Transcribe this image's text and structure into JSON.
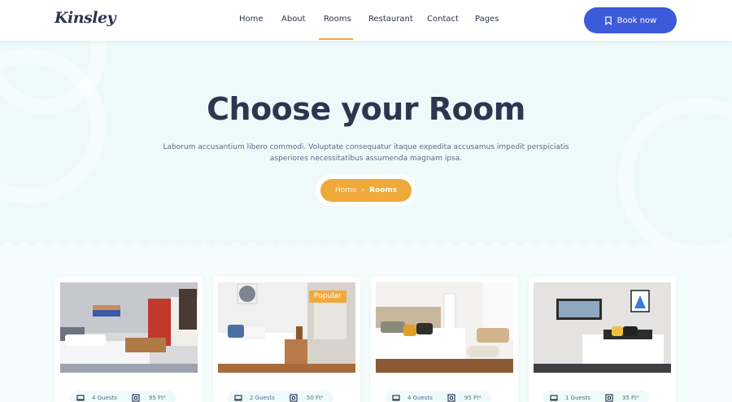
{
  "header": {
    "logo": "Kinsley",
    "nav": [
      {
        "label": "Home"
      },
      {
        "label": "About"
      },
      {
        "label": "Rooms",
        "active": true
      },
      {
        "label": "Restaurant"
      },
      {
        "label": "Contact"
      },
      {
        "label": "Pages"
      }
    ],
    "book_button": "Book now",
    "accent_color": "#3b5bdb"
  },
  "hero": {
    "title": "Choose your Room",
    "subtitle": "Laborum accusantium libero commodi. Voluptate consequatur itaque expedita accusamus impedit perspiciatis asperiores necessitatibus assumenda magnam ipsa.",
    "breadcrumb": {
      "home": "Home",
      "separator": "›",
      "current": "Rooms"
    },
    "breadcrumb_color": "#f0a93b"
  },
  "rooms": [
    {
      "guests": "4 Guests",
      "size": "95 Ft²",
      "badge": "",
      "icons": {
        "guests": "bed-icon",
        "size": "area-icon"
      }
    },
    {
      "guests": "2 Guests",
      "size": "50 Ft²",
      "badge": "Popular",
      "icons": {
        "guests": "bed-icon",
        "size": "area-icon"
      }
    },
    {
      "guests": "4 Guests",
      "size": "95 Ft²",
      "badge": "",
      "icons": {
        "guests": "bed-icon",
        "size": "area-icon"
      }
    },
    {
      "guests": "1 Guests",
      "size": "35 Ft²",
      "badge": "",
      "icons": {
        "guests": "bed-icon",
        "size": "area-icon"
      }
    }
  ]
}
